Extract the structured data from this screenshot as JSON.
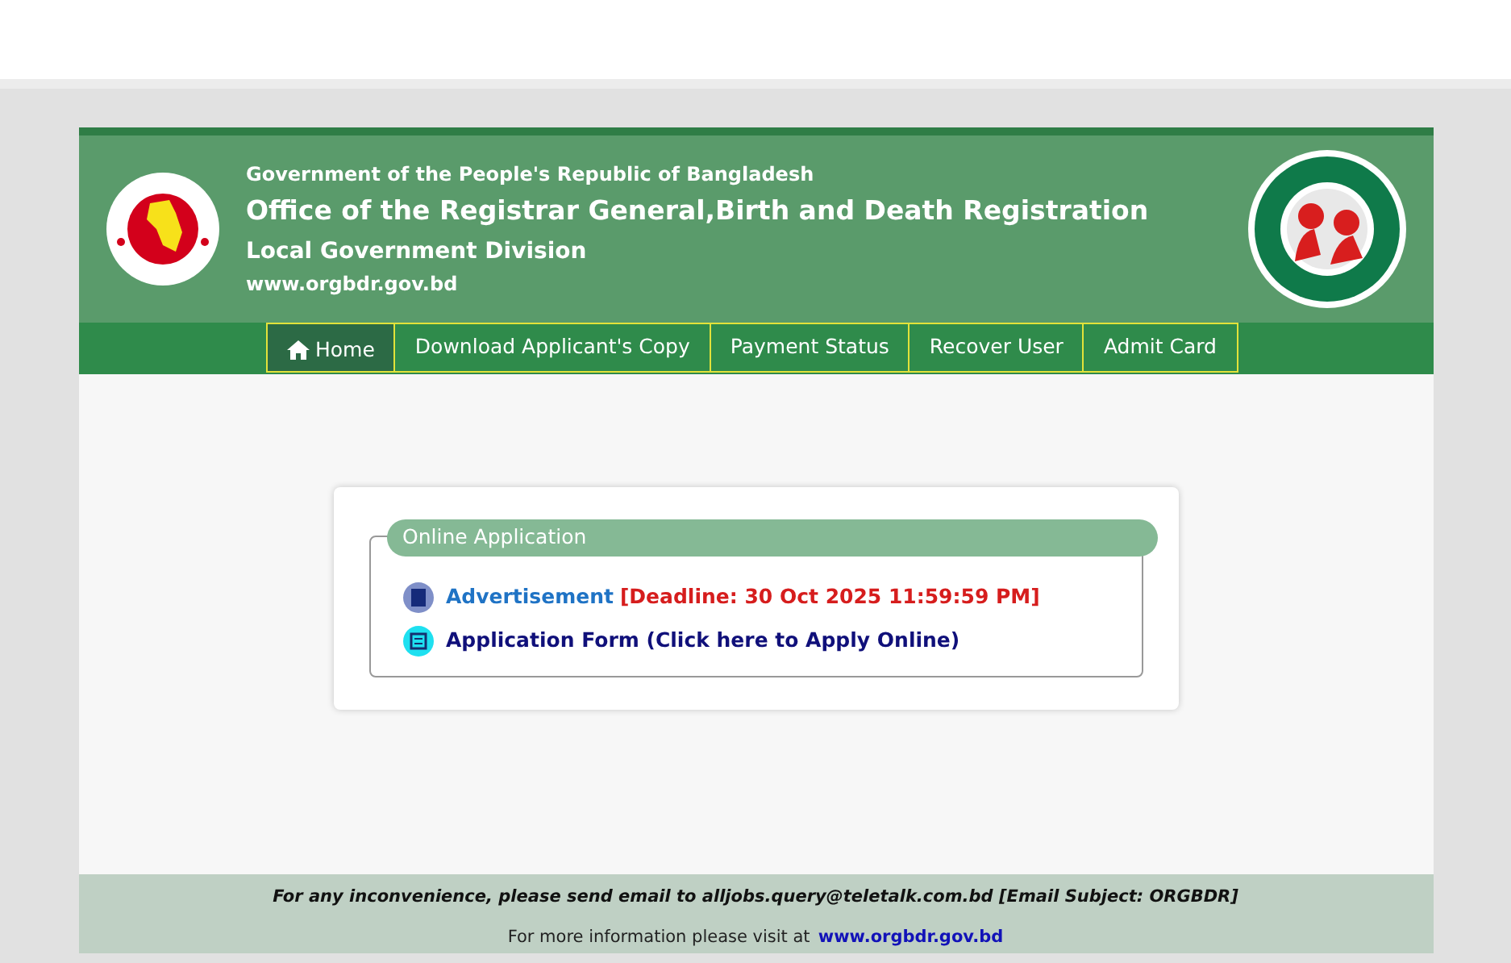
{
  "header": {
    "government": "Government of the People's Republic of Bangladesh",
    "office": "Office of the Registrar General,Birth and Death Registration",
    "division": "Local Government Division",
    "website": "www.orgbdr.gov.bd"
  },
  "nav": [
    {
      "label": "Home",
      "kind": "home",
      "selected": true
    },
    {
      "label": "Download Applicant's Copy",
      "kind": "link",
      "selected": false
    },
    {
      "label": "Payment Status",
      "kind": "link",
      "selected": false
    },
    {
      "label": "Recover User",
      "kind": "link",
      "selected": false
    },
    {
      "label": "Admit Card",
      "kind": "link",
      "selected": false
    }
  ],
  "panel": {
    "legend": "Online Application",
    "links": [
      {
        "kind": "pdf",
        "text": "Advertisement",
        "note": "[Deadline: 30 Oct 2025 11:59:59 PM]"
      },
      {
        "kind": "form",
        "text": "Application Form (Click here to Apply Online)"
      }
    ]
  },
  "footer": {
    "notice": "For any inconvenience, please send email to alljobs.query@teletalk.com.bd [Email Subject: ORGBDR]",
    "info": "For more information please visit at",
    "link": "www.orgbdr.gov.bd"
  }
}
